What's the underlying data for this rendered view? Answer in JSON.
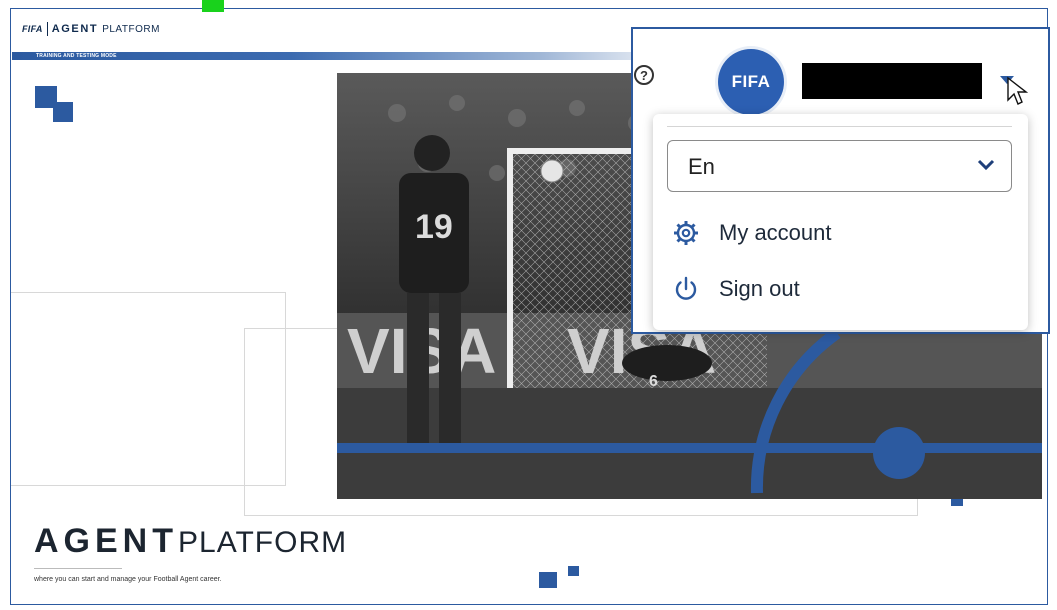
{
  "header": {
    "logo_fifa": "FIFA",
    "logo_agent": "AGENT",
    "logo_platform": "PLATFORM",
    "mode_label": "TRAINING AND TESTING MODE"
  },
  "hero": {
    "title_bold": "AGENT",
    "title_light": "PLATFORM",
    "tagline": "where you can start and manage your Football Agent career."
  },
  "user_menu": {
    "help_glyph": "?",
    "badge_text": "FIFA",
    "language_value": "En",
    "items": [
      {
        "label": "My account",
        "icon": "gear-icon"
      },
      {
        "label": "Sign out",
        "icon": "power-icon"
      }
    ]
  },
  "photo": {
    "jersey_number": "19",
    "goalkeeper_number": "6",
    "ad_board_text": "VISA"
  },
  "colors": {
    "brand_blue": "#2c5aa0",
    "accent_green": "#19d21c",
    "text_dark": "#1c2530"
  }
}
